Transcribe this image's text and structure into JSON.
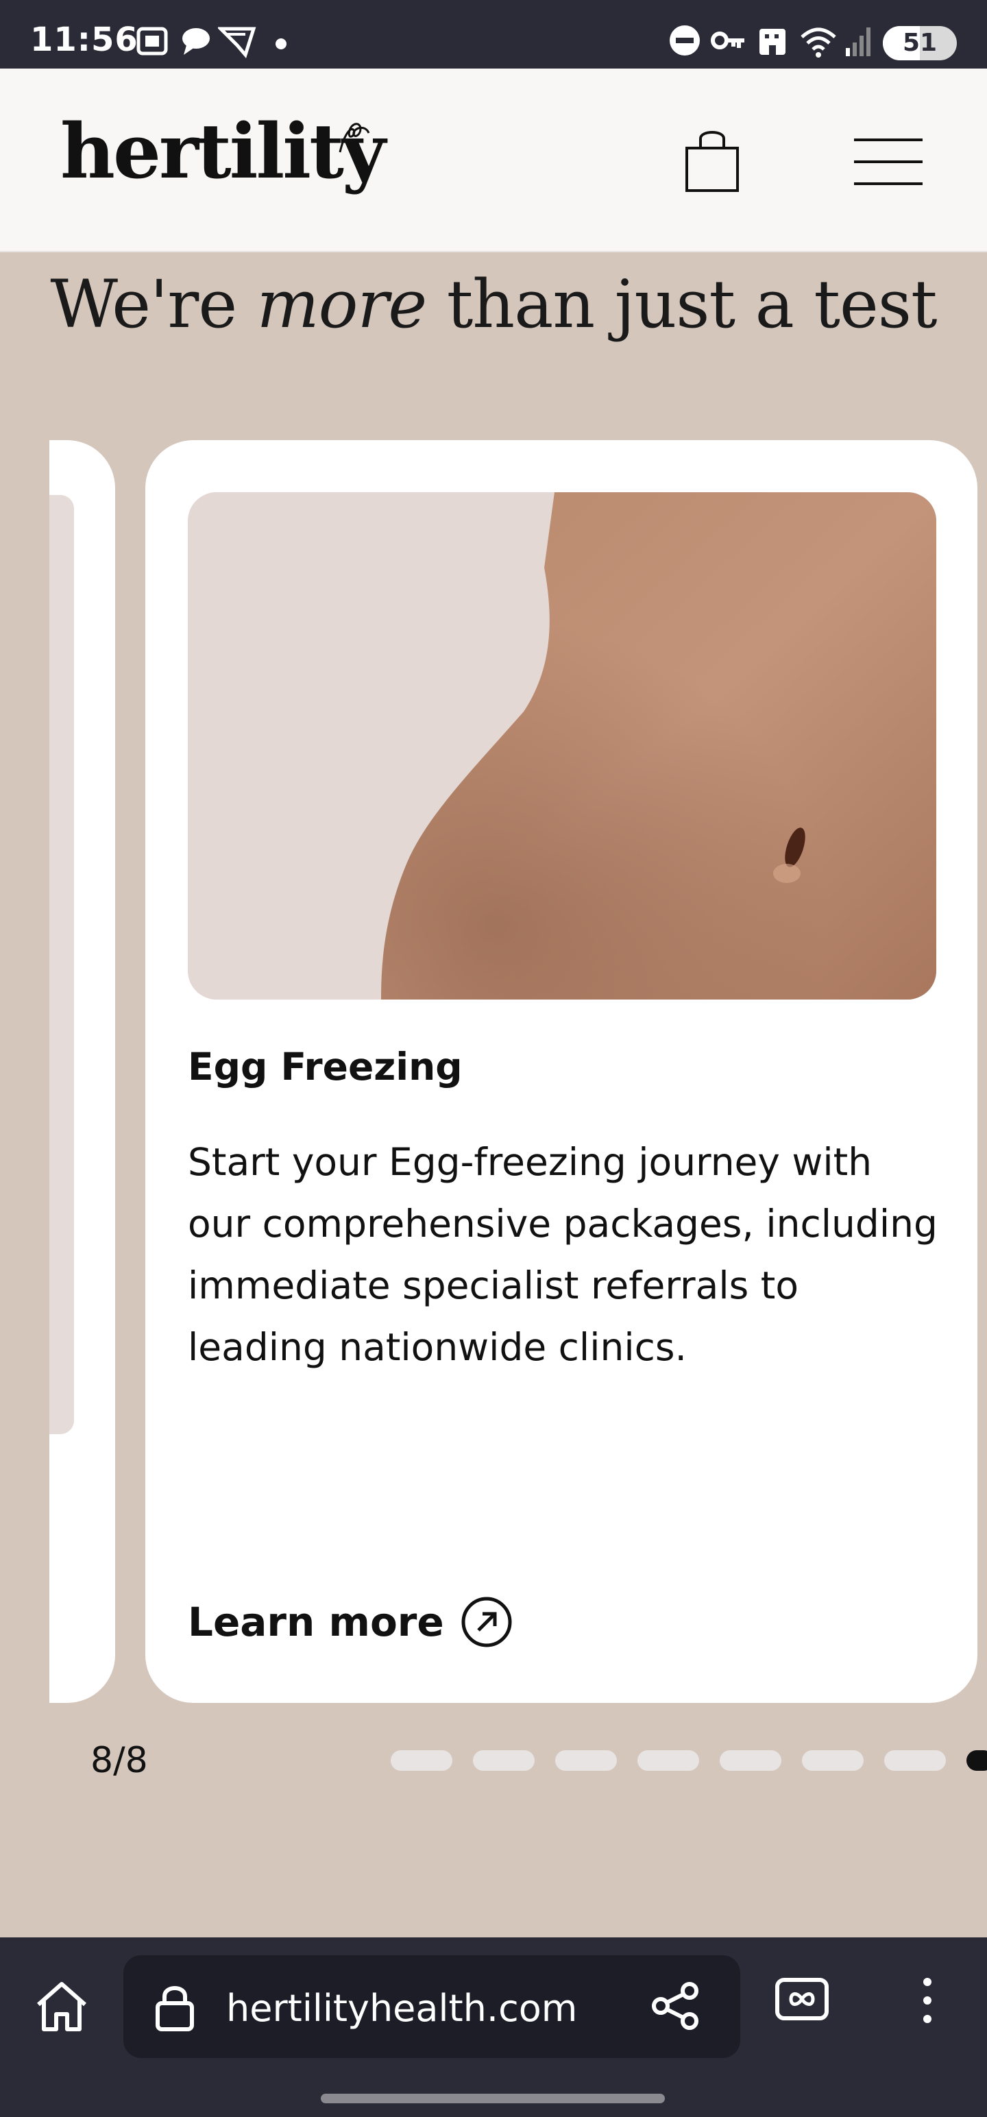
{
  "status_bar": {
    "time": "11:56",
    "battery": "51"
  },
  "header": {
    "logo": "hertility"
  },
  "section": {
    "title_before": "We're",
    "title_em": "more",
    "title_after": "than just a test"
  },
  "card": {
    "title": "Egg Freezing",
    "body": "Start your Egg-freezing journey with our comprehensive packages, including immediate specialist referrals to leading nationwide clinics.",
    "link": "Learn more"
  },
  "pager": {
    "count": "8/8",
    "total": 8,
    "active": 8
  },
  "browser": {
    "url": "hertilityhealth.com"
  },
  "colors": {
    "page_bg": "#d5c6bc",
    "card_bg": "#ffffff",
    "header_bg": "#f8f7f5",
    "system_bar": "#2b2b37"
  }
}
